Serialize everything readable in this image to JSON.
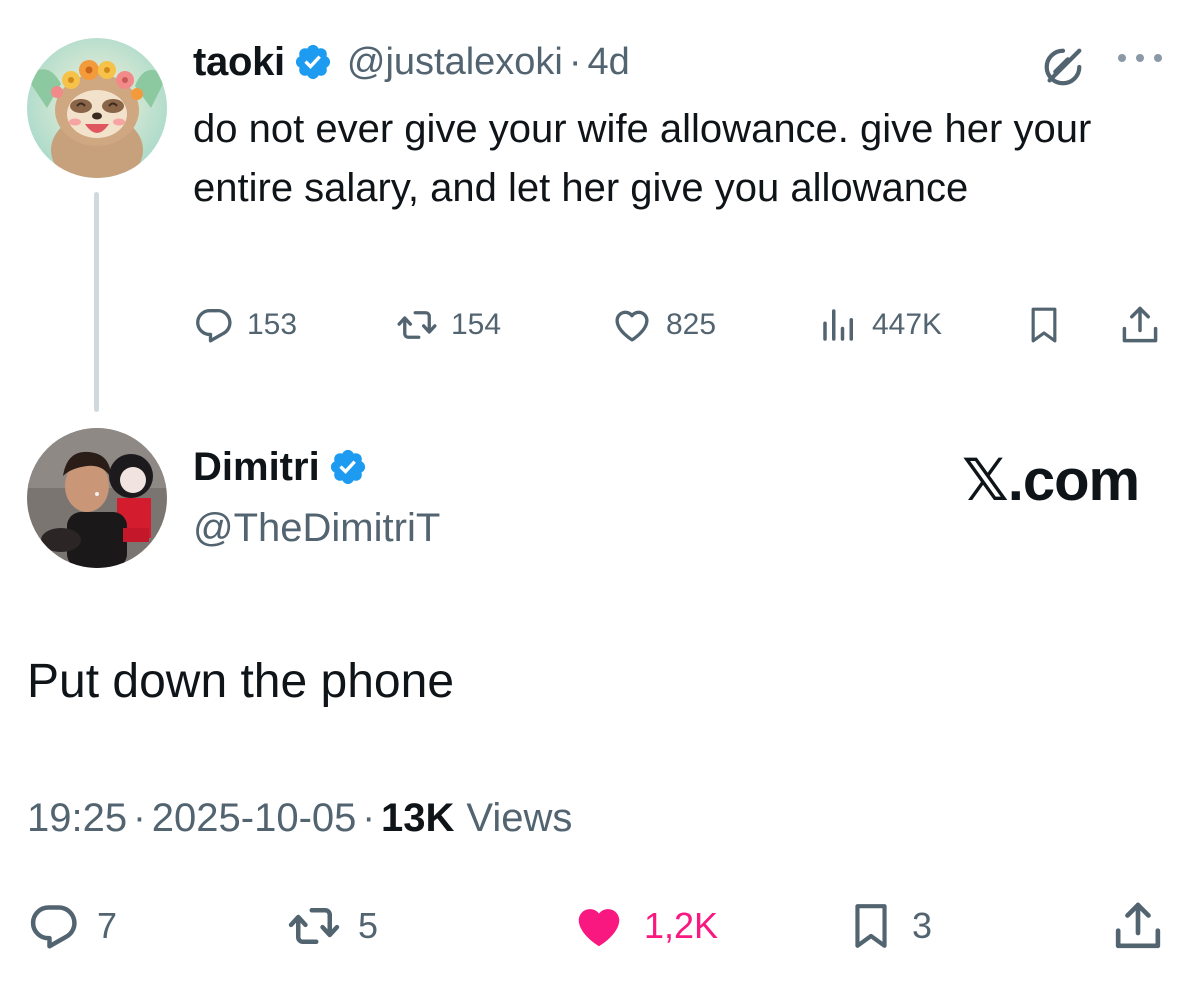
{
  "parent_tweet": {
    "display_name": "taoki",
    "handle": "@justalexoki",
    "separator": "·",
    "age": "4d",
    "text": "do not ever give your wife allowance. give her your entire salary, and let her give you allowance",
    "replies": "153",
    "reposts": "154",
    "likes": "825",
    "views": "447K",
    "icons": [
      "grok-icon",
      "more-icon",
      "reply-icon",
      "retweet-icon",
      "heart-icon",
      "views-icon",
      "bookmark-icon",
      "share-icon"
    ]
  },
  "main_tweet": {
    "display_name": "Dimitri",
    "handle": "@TheDimitriT",
    "brand": "𝕏.com",
    "text": "Put down the phone",
    "time": "19:25",
    "separator": "·",
    "date": "2025-10-05",
    "views_count": "13K",
    "views_label": "Views",
    "replies": "7",
    "reposts": "5",
    "likes": "1,2K",
    "bookmarks": "3"
  },
  "colors": {
    "verified": "#1d9bf0",
    "muted_text": "#536471",
    "like_active": "#f91880",
    "thread_line": "#cfd9de"
  }
}
